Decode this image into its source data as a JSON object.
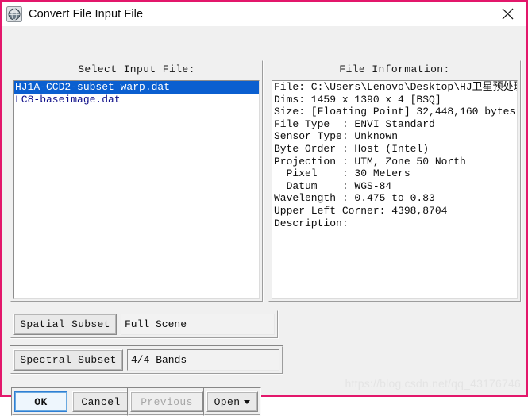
{
  "window": {
    "title": "Convert File Input File",
    "icon": "envi-globe-icon",
    "close_label": "×",
    "border_color": "#e3176b",
    "body_color": "#f0f0f0",
    "titlebar_color": "#ffffff"
  },
  "select_panel": {
    "heading": "Select Input File:",
    "files": [
      {
        "name": "HJ1A-CCD2-subset_warp.dat",
        "selected": true
      },
      {
        "name": "LC8-baseimage.dat",
        "selected": false
      }
    ],
    "selection_color": "#0a5fd0",
    "text_color": "#10108a"
  },
  "info_panel": {
    "heading": "File Information:",
    "lines": [
      "File: C:\\Users\\Lenovo\\Desktop\\HJ卫星预处理",
      "Dims: 1459 x 1390 x 4 [BSQ]",
      "Size: [Floating Point] 32,448,160 bytes.",
      "File Type  : ENVI Standard",
      "Sensor Type: Unknown",
      "Byte Order : Host (Intel)",
      "Projection : UTM, Zone 50 North",
      "  Pixel    : 30 Meters",
      "  Datum    : WGS-84",
      "Wavelength : 0.475 to 0.83",
      "Upper Left Corner: 4398,8704",
      "Description:"
    ]
  },
  "spatial": {
    "button_label": "Spatial Subset",
    "value": "Full Scene"
  },
  "spectral": {
    "button_label": "Spectral Subset",
    "value": "4/4 Bands"
  },
  "buttons": {
    "ok": "OK",
    "cancel": "Cancel",
    "previous": "Previous",
    "open": "Open"
  },
  "watermark": "https://blog.csdn.net/qq_43176746"
}
